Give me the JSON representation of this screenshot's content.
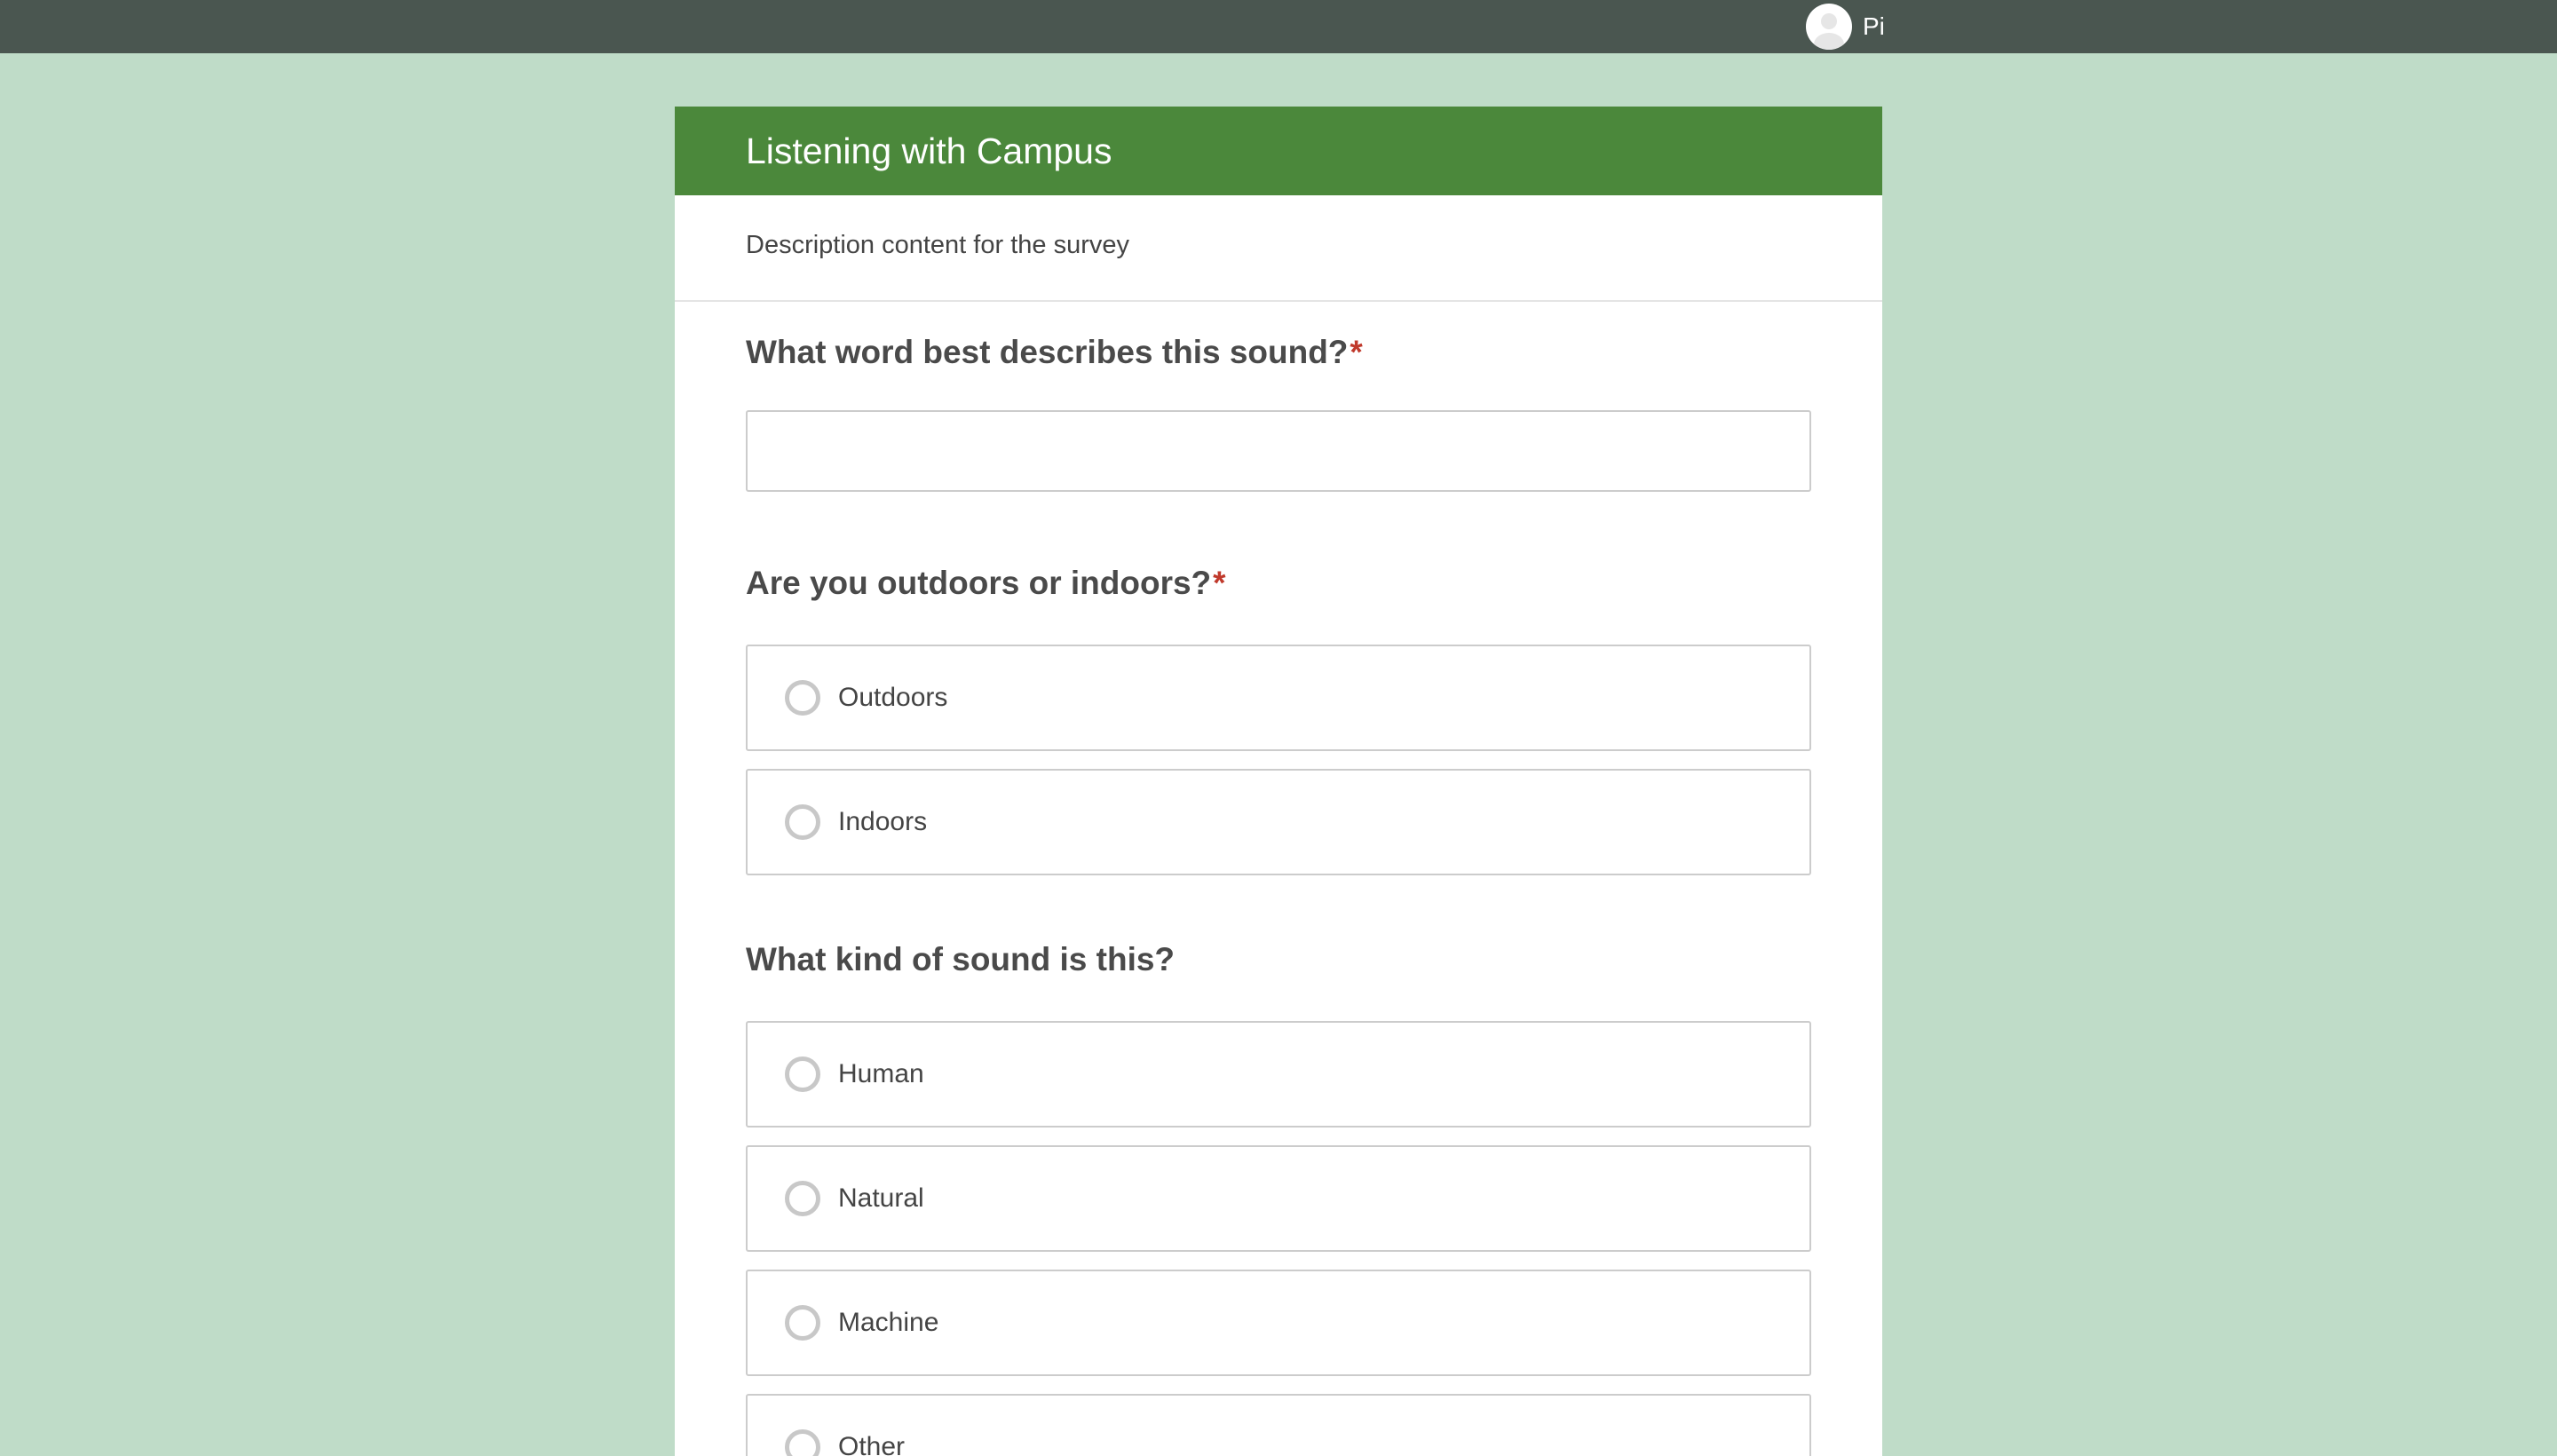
{
  "user": {
    "name": "Pi",
    "avatar_icon": "user-avatar-icon"
  },
  "survey": {
    "title": "Listening with Campus",
    "description": "Description content for the survey",
    "header_color": "#4b883b",
    "required_marker": "*",
    "questions": [
      {
        "title": "What word best describes this sound?",
        "required": true,
        "type": "text",
        "value": "",
        "placeholder": ""
      },
      {
        "title": "Are you outdoors or indoors?",
        "required": true,
        "type": "radio",
        "options": [
          "Outdoors",
          "Indoors"
        ]
      },
      {
        "title": "What kind of sound is this?",
        "required": false,
        "type": "radio",
        "options": [
          "Human",
          "Natural",
          "Machine",
          "Other"
        ]
      }
    ]
  },
  "colors": {
    "topbar": "#4a5650",
    "background": "#bfdcc8",
    "required": "#c0392b"
  }
}
